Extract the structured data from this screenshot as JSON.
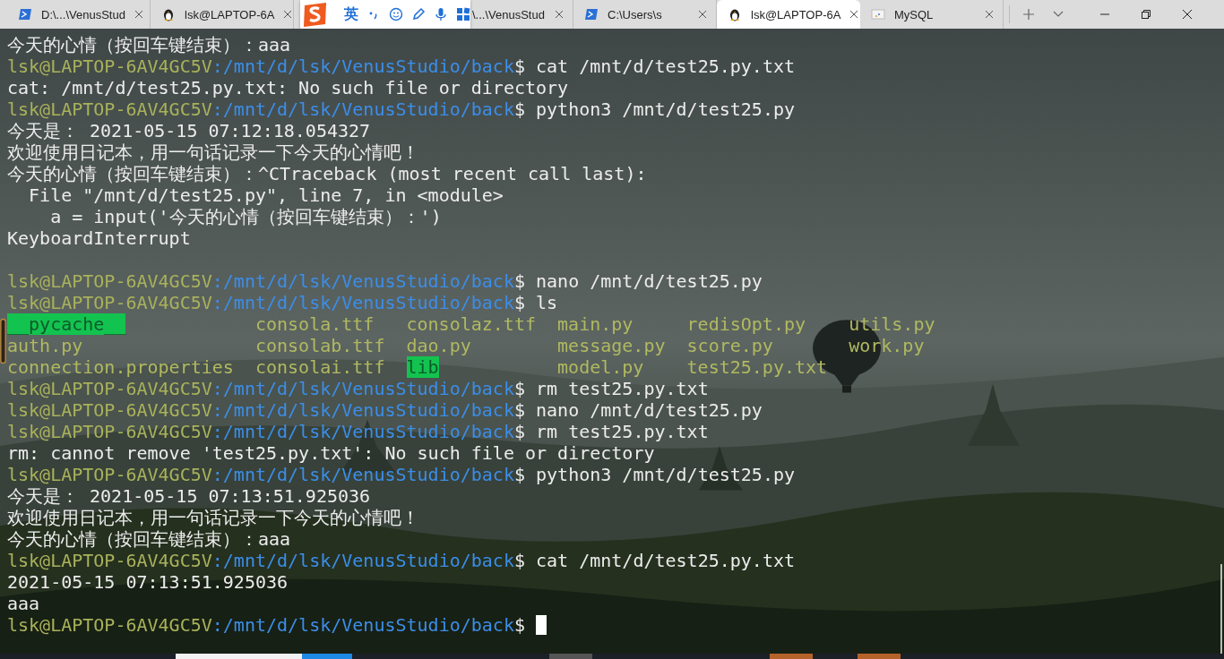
{
  "tabs": [
    {
      "kind": "powershell",
      "title": "D:\\...\\VenusStud",
      "selected": false
    },
    {
      "kind": "linux",
      "title": "lsk@LAPTOP-6A",
      "selected": false
    },
    {
      "kind": "covered",
      "title": "\\...\\VenusStud",
      "selected": false
    },
    {
      "kind": "powershell",
      "title": "C:\\Users\\s",
      "selected": false
    },
    {
      "kind": "linux",
      "title": "lsk@LAPTOP-6A",
      "selected": true
    },
    {
      "kind": "mysql",
      "title": "MySQL",
      "selected": false
    }
  ],
  "ime_toolbar": {
    "mode": "英"
  },
  "terminal": {
    "lines": [
      {
        "kind": "output",
        "text": "今天的心情（按回车键结束）：aaa"
      },
      {
        "kind": "prompt",
        "user": "lsk@LAPTOP-6AV4GC5V",
        "path": ":/mnt/d/lsk/VenusStudio/back",
        "command": "$ cat /mnt/d/test25.py.txt",
        "cursor": false
      },
      {
        "kind": "output",
        "text": "cat: /mnt/d/test25.py.txt: No such file or directory"
      },
      {
        "kind": "prompt",
        "user": "lsk@LAPTOP-6AV4GC5V",
        "path": ":/mnt/d/lsk/VenusStudio/back",
        "command": "$ python3 /mnt/d/test25.py",
        "cursor": false
      },
      {
        "kind": "output",
        "text": "今天是： 2021-05-15 07:12:18.054327"
      },
      {
        "kind": "output",
        "text": "欢迎使用日记本，用一句话记录一下今天的心情吧！"
      },
      {
        "kind": "output",
        "text": "今天的心情（按回车键结束）：^CTraceback (most recent call last):"
      },
      {
        "kind": "output",
        "text": "  File \"/mnt/d/test25.py\", line 7, in <module>"
      },
      {
        "kind": "output",
        "text": "    a = input('今天的心情（按回车键结束）：')"
      },
      {
        "kind": "output",
        "text": "KeyboardInterrupt"
      },
      {
        "kind": "blank"
      },
      {
        "kind": "prompt",
        "user": "lsk@LAPTOP-6AV4GC5V",
        "path": ":/mnt/d/lsk/VenusStudio/back",
        "command": "$ nano /mnt/d/test25.py",
        "cursor": false
      },
      {
        "kind": "prompt",
        "user": "lsk@LAPTOP-6AV4GC5V",
        "path": ":/mnt/d/lsk/VenusStudio/back",
        "command": "$ ls",
        "cursor": false
      },
      {
        "kind": "ls",
        "rows": [
          [
            {
              "name": "__pycache__",
              "highlight": true
            },
            {
              "name": "consola.ttf",
              "highlight": false
            },
            {
              "name": "consolaz.ttf",
              "highlight": false
            },
            {
              "name": "main.py",
              "highlight": false
            },
            {
              "name": "redisOpt.py",
              "highlight": false
            },
            {
              "name": "utils.py",
              "highlight": false
            }
          ],
          [
            {
              "name": "auth.py",
              "highlight": false
            },
            {
              "name": "consolab.ttf",
              "highlight": false
            },
            {
              "name": "dao.py",
              "highlight": false
            },
            {
              "name": "message.py",
              "highlight": false
            },
            {
              "name": "score.py",
              "highlight": false
            },
            {
              "name": "work.py",
              "highlight": false
            }
          ],
          [
            {
              "name": "connection.properties",
              "highlight": false
            },
            {
              "name": "consolai.ttf",
              "highlight": false
            },
            {
              "name": "lib",
              "highlight": true
            },
            {
              "name": "model.py",
              "highlight": false
            },
            {
              "name": "test25.py.txt",
              "highlight": false
            }
          ]
        ]
      },
      {
        "kind": "prompt",
        "user": "lsk@LAPTOP-6AV4GC5V",
        "path": ":/mnt/d/lsk/VenusStudio/back",
        "command": "$ rm test25.py.txt",
        "cursor": false
      },
      {
        "kind": "prompt",
        "user": "lsk@LAPTOP-6AV4GC5V",
        "path": ":/mnt/d/lsk/VenusStudio/back",
        "command": "$ nano /mnt/d/test25.py",
        "cursor": false
      },
      {
        "kind": "prompt",
        "user": "lsk@LAPTOP-6AV4GC5V",
        "path": ":/mnt/d/lsk/VenusStudio/back",
        "command": "$ rm test25.py.txt",
        "cursor": false
      },
      {
        "kind": "output",
        "text": "rm: cannot remove 'test25.py.txt': No such file or directory"
      },
      {
        "kind": "prompt",
        "user": "lsk@LAPTOP-6AV4GC5V",
        "path": ":/mnt/d/lsk/VenusStudio/back",
        "command": "$ python3 /mnt/d/test25.py",
        "cursor": false
      },
      {
        "kind": "output",
        "text": "今天是： 2021-05-15 07:13:51.925036"
      },
      {
        "kind": "output",
        "text": "欢迎使用日记本，用一句话记录一下今天的心情吧！"
      },
      {
        "kind": "output",
        "text": "今天的心情（按回车键结束）：aaa"
      },
      {
        "kind": "prompt",
        "user": "lsk@LAPTOP-6AV4GC5V",
        "path": ":/mnt/d/lsk/VenusStudio/back",
        "command": "$ cat /mnt/d/test25.py.txt",
        "cursor": false
      },
      {
        "kind": "output",
        "text": "2021-05-15 07:13:51.925036"
      },
      {
        "kind": "output",
        "text": "aaa"
      },
      {
        "kind": "prompt",
        "user": "lsk@LAPTOP-6AV4GC5V",
        "path": ":/mnt/d/lsk/VenusStudio/back",
        "command": "$",
        "cursor": true
      }
    ]
  }
}
